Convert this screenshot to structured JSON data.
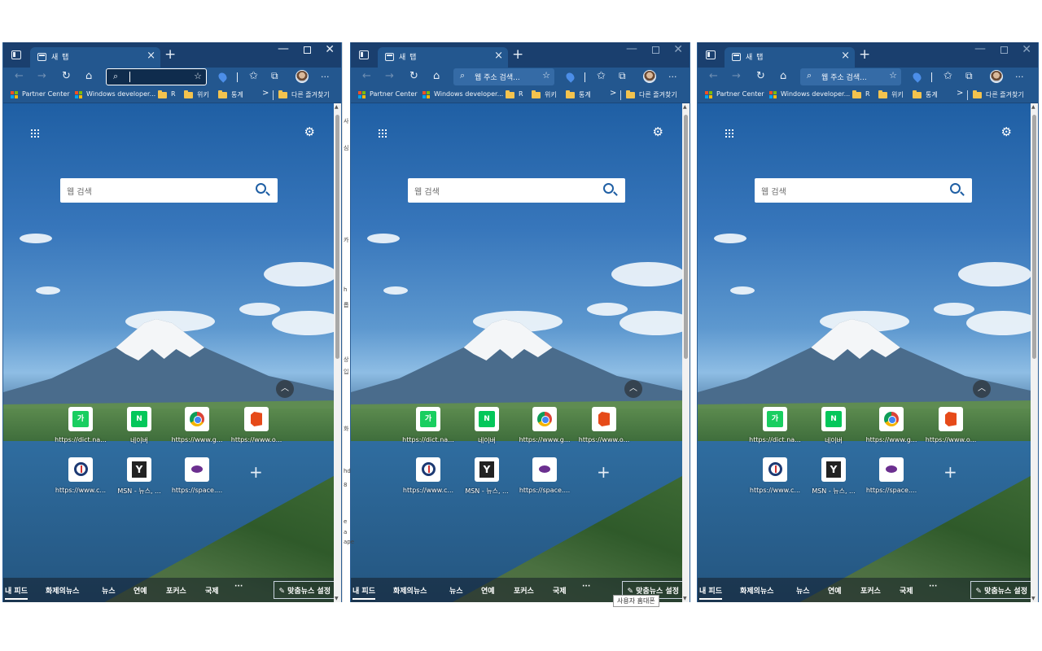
{
  "tab": {
    "title": "새 탭",
    "close": "×",
    "new": "+"
  },
  "window_controls": {
    "min": "—",
    "close": "✕"
  },
  "toolbar": {
    "back": "←",
    "forward": "→",
    "refresh": "↻",
    "home": "⌂",
    "more": "···",
    "address_placeholder": "웹 주소 검색..."
  },
  "favorites": [
    {
      "label": "Partner Center"
    },
    {
      "label": "Windows developer..."
    },
    {
      "label": "R"
    },
    {
      "label": "위키"
    },
    {
      "label": "통계"
    }
  ],
  "favorites_overflow": ">",
  "other_favorites": "다른 즐겨찾기",
  "newtab": {
    "search_placeholder": "웹 검색",
    "collapse": "︿",
    "add_tile": "+",
    "tiles": [
      {
        "label": "https://dict.na...",
        "glyph": "가",
        "color": "#19ce60"
      },
      {
        "label": "네이버",
        "glyph": "N",
        "color": "#03c75a"
      },
      {
        "label": "https://www.g...",
        "glyph": "",
        "color": ""
      },
      {
        "label": "https://www.o...",
        "glyph": "",
        "color": ""
      },
      {
        "label": "https://www.c...",
        "glyph": "",
        "color": ""
      },
      {
        "label": "MSN - 뉴스, ...",
        "glyph": "Y",
        "color": "#222222"
      },
      {
        "label": "https://space....",
        "glyph": "",
        "color": ""
      }
    ]
  },
  "feed": {
    "items": [
      "내 피드",
      "화제의뉴스",
      "뉴스",
      "연예",
      "포커스",
      "국제"
    ],
    "more": "···",
    "personalize": "✎ 맞춤뉴스 설정"
  },
  "tooltip": "사용자 홈대폰",
  "peek_text": [
    "사",
    "심",
    "카",
    "h",
    "롭",
    "상",
    "입",
    "화",
    "hd",
    "8",
    "e",
    "a",
    "ape"
  ]
}
